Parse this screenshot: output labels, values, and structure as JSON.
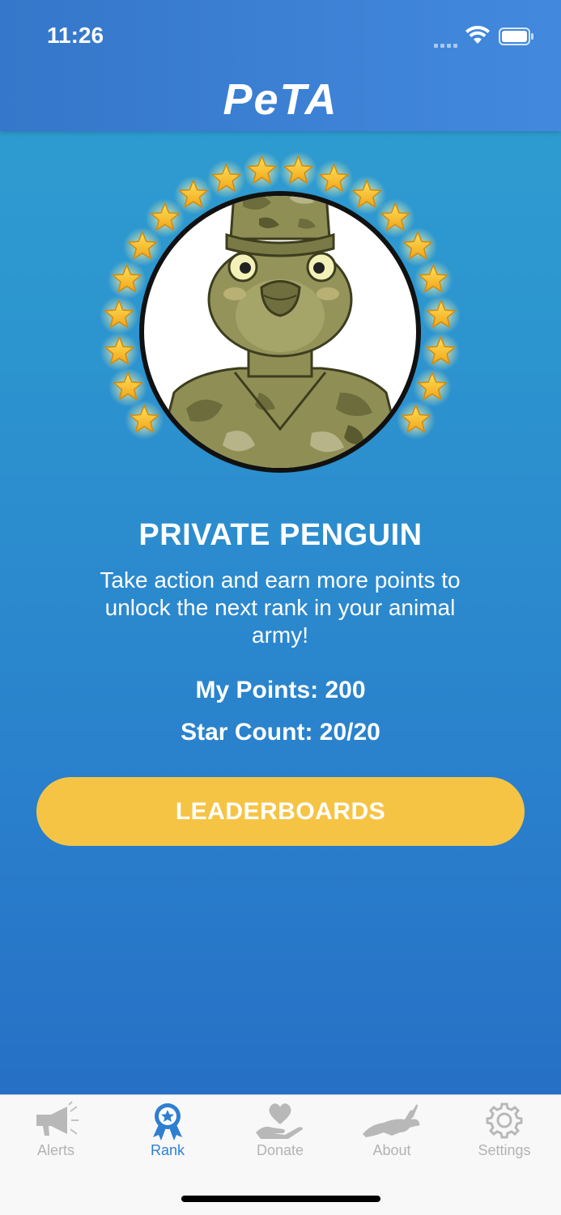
{
  "status": {
    "time": "11:26"
  },
  "header": {
    "logo": "PeTA"
  },
  "rank": {
    "title": "PRIVATE PENGUIN",
    "description": "Take action and earn more points to unlock the next rank in your animal army!",
    "points_text": "My Points: 200",
    "stars_text": "Star Count: 20/20",
    "stars_earned": 20,
    "stars_total": 20
  },
  "leaderboards_button": "LEADERBOARDS",
  "tabs": [
    {
      "label": "Alerts",
      "icon": "megaphone-icon"
    },
    {
      "label": "Rank",
      "icon": "ribbon-badge-icon"
    },
    {
      "label": "Donate",
      "icon": "heart-hand-icon"
    },
    {
      "label": "About",
      "icon": "rabbit-icon"
    },
    {
      "label": "Settings",
      "icon": "gear-icon"
    }
  ],
  "colors": {
    "header": "#3a7fd2",
    "background": "#2c8fcf",
    "button": "#f6c445",
    "active_tab": "#2f7fd0",
    "inactive_tab": "#b3b3b3"
  }
}
